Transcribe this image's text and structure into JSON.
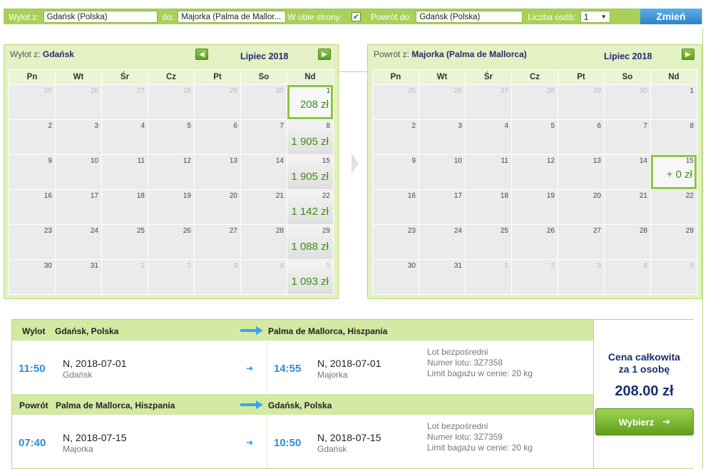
{
  "search": {
    "from_label": "Wylot z:",
    "from_value": "Gdańsk (Polska)",
    "to_label": "do:",
    "to_value": "Majorka (Palma de Mallor...",
    "both_ways_label": "W obie strony:",
    "both_ways_checked": "✔",
    "return_label": "Powrót do:",
    "return_value": "Gdańsk (Polska)",
    "people_label": "Liczba osób:",
    "people_value": "1",
    "change_button": "Zmień"
  },
  "weekdays": [
    "Pn",
    "Wt",
    "Śr",
    "Cz",
    "Pt",
    "So",
    "Nd"
  ],
  "outbound_calendar": {
    "title_prefix": "Wylot z:",
    "title_city": "Gdańsk",
    "month": "Lipiec 2018",
    "weeks": [
      [
        {
          "d": "25",
          "o": true
        },
        {
          "d": "26",
          "o": true
        },
        {
          "d": "27",
          "o": true
        },
        {
          "d": "28",
          "o": true
        },
        {
          "d": "29",
          "o": true
        },
        {
          "d": "30",
          "o": true
        },
        {
          "d": "1",
          "p": "208 zł",
          "s": true
        }
      ],
      [
        {
          "d": "2"
        },
        {
          "d": "3"
        },
        {
          "d": "4"
        },
        {
          "d": "5"
        },
        {
          "d": "6"
        },
        {
          "d": "7"
        },
        {
          "d": "8",
          "p": "1 905 zł"
        }
      ],
      [
        {
          "d": "9"
        },
        {
          "d": "10"
        },
        {
          "d": "11"
        },
        {
          "d": "12"
        },
        {
          "d": "13"
        },
        {
          "d": "14"
        },
        {
          "d": "15",
          "p": "1 905 zł"
        }
      ],
      [
        {
          "d": "16"
        },
        {
          "d": "17"
        },
        {
          "d": "18"
        },
        {
          "d": "19"
        },
        {
          "d": "20"
        },
        {
          "d": "21"
        },
        {
          "d": "22",
          "p": "1 142 zł"
        }
      ],
      [
        {
          "d": "23"
        },
        {
          "d": "24"
        },
        {
          "d": "25"
        },
        {
          "d": "26"
        },
        {
          "d": "27"
        },
        {
          "d": "28"
        },
        {
          "d": "29",
          "p": "1 088 zł"
        }
      ],
      [
        {
          "d": "30"
        },
        {
          "d": "31"
        },
        {
          "d": "1",
          "o": true
        },
        {
          "d": "2",
          "o": true
        },
        {
          "d": "3",
          "o": true
        },
        {
          "d": "4",
          "o": true
        },
        {
          "d": "5",
          "o": true,
          "p": "1 093 zł"
        }
      ]
    ]
  },
  "return_calendar": {
    "title_prefix": "Powrót z:",
    "title_city": "Majorka (Palma de Mallorca)",
    "month": "Lipiec 2018",
    "weeks": [
      [
        {
          "d": "25",
          "o": true
        },
        {
          "d": "26",
          "o": true
        },
        {
          "d": "27",
          "o": true
        },
        {
          "d": "28",
          "o": true
        },
        {
          "d": "29",
          "o": true
        },
        {
          "d": "30",
          "o": true
        },
        {
          "d": "1"
        }
      ],
      [
        {
          "d": "2"
        },
        {
          "d": "3"
        },
        {
          "d": "4"
        },
        {
          "d": "5"
        },
        {
          "d": "6"
        },
        {
          "d": "7"
        },
        {
          "d": "8"
        }
      ],
      [
        {
          "d": "9"
        },
        {
          "d": "10"
        },
        {
          "d": "11"
        },
        {
          "d": "12"
        },
        {
          "d": "13"
        },
        {
          "d": "14"
        },
        {
          "d": "15",
          "p": "+ 0 zł",
          "s": true
        }
      ],
      [
        {
          "d": "16"
        },
        {
          "d": "17"
        },
        {
          "d": "18"
        },
        {
          "d": "19"
        },
        {
          "d": "20"
        },
        {
          "d": "21"
        },
        {
          "d": "22"
        }
      ],
      [
        {
          "d": "23"
        },
        {
          "d": "24"
        },
        {
          "d": "25"
        },
        {
          "d": "26"
        },
        {
          "d": "27"
        },
        {
          "d": "28"
        },
        {
          "d": "29"
        }
      ],
      [
        {
          "d": "30"
        },
        {
          "d": "31"
        },
        {
          "d": "1",
          "o": true
        },
        {
          "d": "2",
          "o": true
        },
        {
          "d": "3",
          "o": true
        },
        {
          "d": "4",
          "o": true
        },
        {
          "d": "5",
          "o": true
        }
      ]
    ]
  },
  "outbound_leg": {
    "label": "Wylot",
    "from": "Gdańsk, Polska",
    "to": "Palma de Mallorca, Hiszpania",
    "dep_time": "11:50",
    "dep_date": "N, 2018-07-01",
    "dep_city": "Gdańsk",
    "arr_time": "14:55",
    "arr_date": "N, 2018-07-01",
    "arr_city": "Majorka",
    "info1": "Lot bezpośredni",
    "info2": "Numer lotu: 3Z7358",
    "info3": "Limit bagażu w cenie: 20 kg"
  },
  "return_leg": {
    "label": "Powrót",
    "from": "Palma de Mallorca, Hiszpania",
    "to": "Gdańsk, Polska",
    "dep_time": "07:40",
    "dep_date": "N, 2018-07-15",
    "dep_city": "Majorka",
    "arr_time": "10:50",
    "arr_date": "N, 2018-07-15",
    "arr_city": "Gdańsk",
    "info1": "Lot bezpośredni",
    "info2": "Numer lotu: 3Z7359",
    "info3": "Limit bagażu w cenie: 20 kg"
  },
  "price": {
    "label_line1": "Cena całkowita",
    "label_line2": "za 1 osobę",
    "value": "208.00 zł",
    "select_button": "Wybierz"
  },
  "colors": {
    "accent_green": "#a9d05a",
    "price_green": "#3d8d16",
    "time_blue": "#2c8ed6",
    "navy": "#1c2f6e"
  }
}
